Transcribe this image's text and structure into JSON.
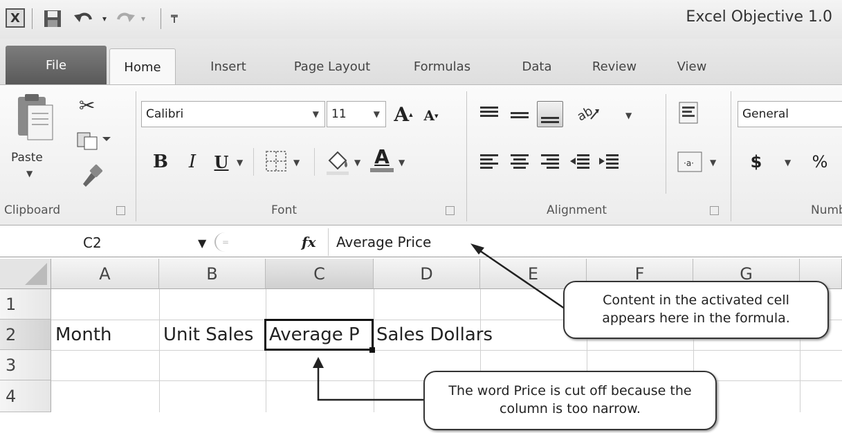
{
  "app": {
    "title": "Excel Objective 1.0",
    "logo_letter": "X"
  },
  "quick_access": {
    "save_icon": "save-icon",
    "undo_icon": "undo-icon",
    "redo_icon": "redo-icon",
    "customize_icon": "customize-qat-icon"
  },
  "tabs": [
    {
      "label": "File"
    },
    {
      "label": "Home"
    },
    {
      "label": "Insert"
    },
    {
      "label": "Page Layout"
    },
    {
      "label": "Formulas"
    },
    {
      "label": "Data"
    },
    {
      "label": "Review"
    },
    {
      "label": "View"
    }
  ],
  "ribbon": {
    "clipboard": {
      "label": "Clipboard",
      "paste_label": "Paste"
    },
    "font": {
      "label": "Font",
      "font_name": "Calibri",
      "font_size": "11",
      "bold": "B",
      "italic": "I",
      "underline": "U",
      "grow": "A",
      "shrink": "A",
      "font_color": "A"
    },
    "alignment": {
      "label": "Alignment"
    },
    "number": {
      "label": "Numb",
      "format": "General",
      "currency": "$",
      "percent": "%"
    }
  },
  "formula_bar": {
    "name_box": "C2",
    "fx": "fx",
    "content": "Average Price"
  },
  "grid": {
    "columns": [
      "A",
      "B",
      "C",
      "D",
      "E",
      "F",
      "G"
    ],
    "rows": [
      "1",
      "2",
      "3",
      "4"
    ],
    "cells": {
      "A2": "Month",
      "B2": "Unit Sales",
      "C2": "Average P",
      "D2": "Sales Dollars"
    },
    "active_cell": "C2"
  },
  "callouts": {
    "formula": "Content in the activated cell appears here in the formula.",
    "cutoff": "The word Price is cut off because the column is too narrow."
  }
}
